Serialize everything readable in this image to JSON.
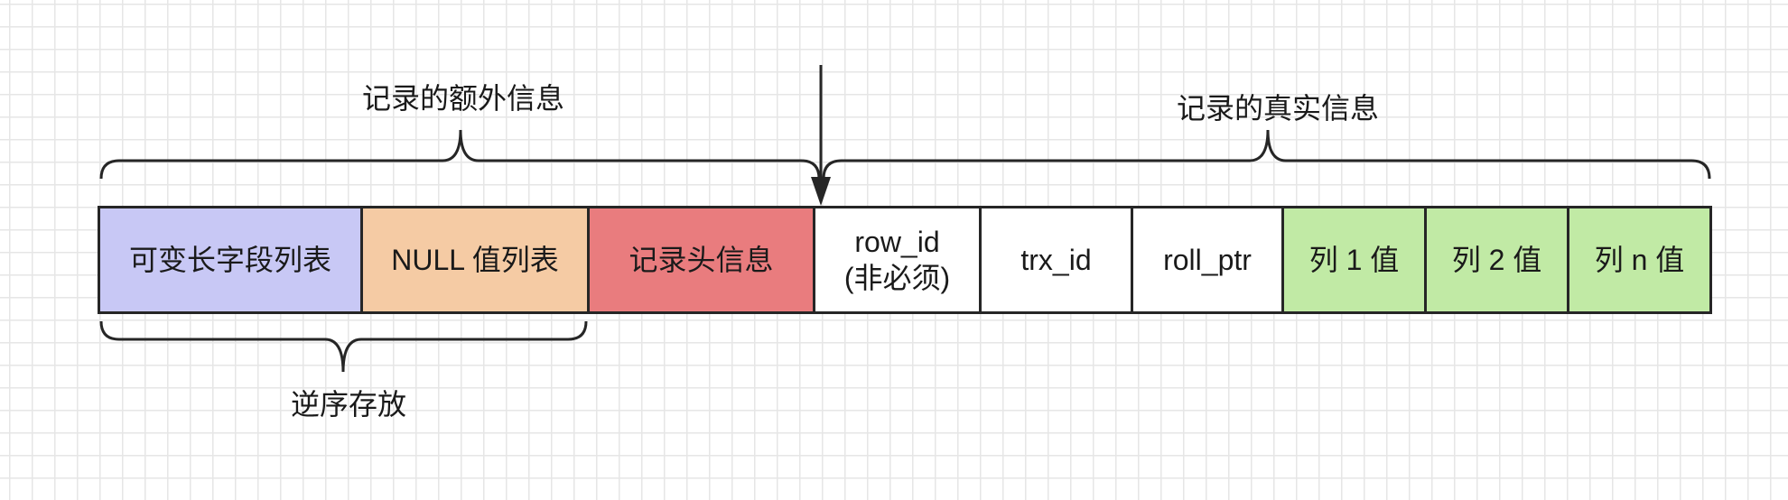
{
  "diagram": {
    "title": "",
    "labels": {
      "extra_info": "记录的额外信息",
      "real_info": "记录的真实信息",
      "reverse_storage": "逆序存放"
    },
    "cells": [
      {
        "id": "var-length-list",
        "text": "可变长字段列表",
        "fill": "#c8c8f5"
      },
      {
        "id": "null-value-list",
        "text": "NULL 值列表",
        "fill": "#f5cba4"
      },
      {
        "id": "record-header",
        "text": "记录头信息",
        "fill": "#e97c7e"
      },
      {
        "id": "row-id",
        "text": "row_id\n(非必须)",
        "fill": "#ffffff"
      },
      {
        "id": "trx-id",
        "text": "trx_id",
        "fill": "#ffffff"
      },
      {
        "id": "roll-ptr",
        "text": "roll_ptr",
        "fill": "#ffffff"
      },
      {
        "id": "column-1",
        "text": "列 1 值",
        "fill": "#c1eaa5"
      },
      {
        "id": "column-2",
        "text": "列 2 值",
        "fill": "#c1eaa5"
      },
      {
        "id": "column-n",
        "text": "列 n 值",
        "fill": "#c1eaa5"
      }
    ],
    "colors": {
      "stroke": "#262626",
      "grid": "#e6e6e6"
    }
  }
}
